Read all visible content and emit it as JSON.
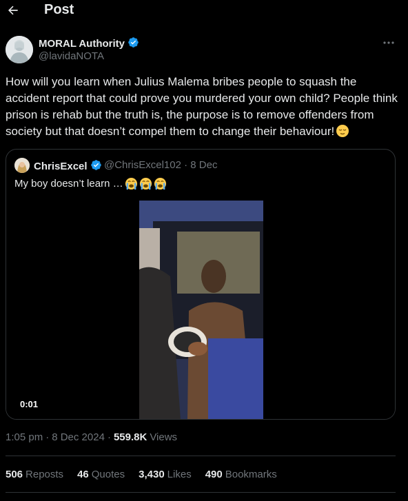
{
  "header": {
    "title": "Post"
  },
  "author": {
    "name": "MORAL Authority",
    "handle": "@lavidaNOTA",
    "verified_color": "#1d9bf0"
  },
  "tweet": {
    "text": "How will you learn when Julius Malema bribes people to squash the accident report that could prove you murdered your own child? People think prison is rehab but the truth is, the purpose is to remove offenders from society but that doesn’t compel them to change their behaviour!",
    "emoji": "relieved-face-emoji"
  },
  "quote": {
    "name": "ChrisExcel",
    "handle": "@ChrisExcel102",
    "separator": "·",
    "date": "8 Dec",
    "text": "My boy doesn’t learn …",
    "emojis": [
      "loudly-crying-face-emoji",
      "loudly-crying-face-emoji",
      "loudly-crying-face-emoji"
    ],
    "video_duration": "0:01"
  },
  "meta": {
    "time": "1:05 pm",
    "sep1": "·",
    "date": "8 Dec 2024",
    "sep2": "·",
    "views_count": "559.8K",
    "views_label": "Views"
  },
  "stats": {
    "reposts_count": "506",
    "reposts_label": "Reposts",
    "quotes_count": "46",
    "quotes_label": "Quotes",
    "likes_count": "3,430",
    "likes_label": "Likes",
    "bookmarks_count": "490",
    "bookmarks_label": "Bookmarks"
  },
  "colors": {
    "background": "#000000",
    "text": "#e7e9ea",
    "muted": "#71767b",
    "border": "#2f3336",
    "accent": "#1d9bf0"
  }
}
